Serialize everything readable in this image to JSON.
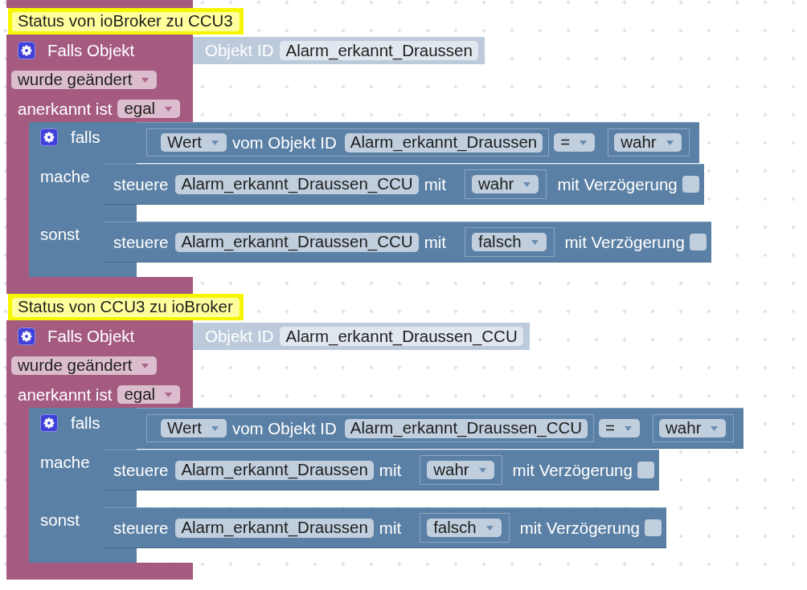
{
  "workspace": {
    "blocks": [
      {
        "kind": "comment",
        "text": "Status von ioBroker zu CCU3"
      },
      {
        "kind": "trigger",
        "label": "Falls Objekt",
        "object_label": "Objekt ID",
        "object_id": "Alarm_erkannt_Draussen",
        "event": "wurde geändert",
        "ack_label": "anerkannt ist",
        "ack": "egal",
        "body": {
          "if_label": "falls",
          "condition": {
            "property": "Wert",
            "of_label": "vom Objekt ID",
            "object_id": "Alarm_erkannt_Draussen",
            "operator": "=",
            "value": "wahr"
          },
          "then_label": "mache",
          "then": {
            "label": "steuere",
            "object_id": "Alarm_erkannt_Draussen_CCU",
            "with_label": "mit",
            "value": "wahr",
            "delay_label": "mit Verzögerung",
            "delay": false
          },
          "else_label": "sonst",
          "else": {
            "label": "steuere",
            "object_id": "Alarm_erkannt_Draussen_CCU",
            "with_label": "mit",
            "value": "falsch",
            "delay_label": "mit Verzögerung",
            "delay": false
          }
        }
      },
      {
        "kind": "comment",
        "text": "Status von CCU3 zu ioBroker"
      },
      {
        "kind": "trigger",
        "label": "Falls Objekt",
        "object_label": "Objekt ID",
        "object_id": "Alarm_erkannt_Draussen_CCU",
        "event": "wurde geändert",
        "ack_label": "anerkannt ist",
        "ack": "egal",
        "body": {
          "if_label": "falls",
          "condition": {
            "property": "Wert",
            "of_label": "vom Objekt ID",
            "object_id": "Alarm_erkannt_Draussen_CCU",
            "operator": "=",
            "value": "wahr"
          },
          "then_label": "mache",
          "then": {
            "label": "steuere",
            "object_id": "Alarm_erkannt_Draussen",
            "with_label": "mit",
            "value": "wahr",
            "delay_label": "mit Verzögerung",
            "delay": false
          },
          "else_label": "sonst",
          "else": {
            "label": "steuere",
            "object_id": "Alarm_erkannt_Draussen",
            "with_label": "mit",
            "value": "falsch",
            "delay_label": "mit Verzögerung",
            "delay": false
          }
        }
      }
    ]
  }
}
